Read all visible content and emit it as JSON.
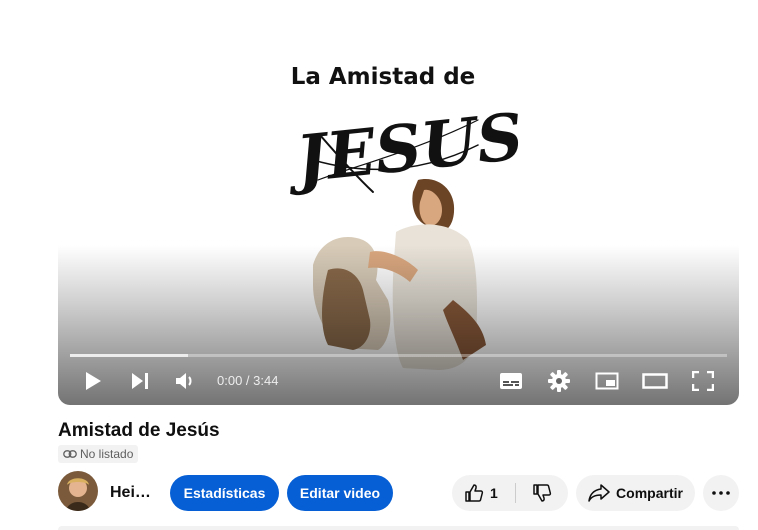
{
  "video": {
    "poster_text_top": "La Amistad de",
    "poster_text_big": "JESUS",
    "current_time": "0:00",
    "duration": "3:44",
    "time_display": "0:00 / 3:44",
    "buffered_fraction": 0.18
  },
  "title": "Amistad de Jesús",
  "privacy_label": "No listado",
  "channel": {
    "name": "Hei…"
  },
  "buttons": {
    "stats": "Estadísticas",
    "edit": "Editar video",
    "like_count": "1",
    "share": "Compartir"
  },
  "icons": {
    "play": "play-icon",
    "next": "next-icon",
    "volume": "volume-icon",
    "subtitles": "subtitles-icon",
    "settings": "gear-icon",
    "miniplayer": "miniplayer-icon",
    "theater": "theater-icon",
    "fullscreen": "fullscreen-icon",
    "link": "link-icon",
    "like": "thumbs-up-icon",
    "dislike": "thumbs-down-icon",
    "share": "share-icon",
    "more": "more-icon"
  },
  "colors": {
    "accent": "#065fd4",
    "chip": "#f2f2f2",
    "text": "#0f0f0f"
  }
}
